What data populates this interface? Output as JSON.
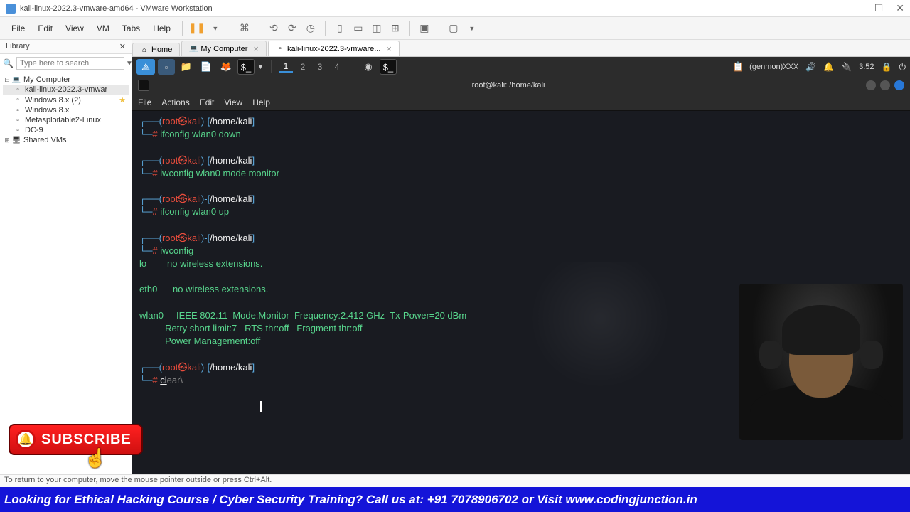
{
  "window": {
    "title": "kali-linux-2022.3-vmware-amd64 - VMware Workstation"
  },
  "menubar": {
    "items": [
      "File",
      "Edit",
      "View",
      "VM",
      "Tabs",
      "Help"
    ]
  },
  "library": {
    "title": "Library",
    "search_placeholder": "Type here to search",
    "tree": {
      "my_computer": "My Computer",
      "kali": "kali-linux-2022.3-vmwar",
      "win8x2": "Windows 8.x (2)",
      "win8x": "Windows 8.x",
      "metasploit": "Metasploitable2-Linux",
      "dc9": "DC-9",
      "shared": "Shared VMs"
    }
  },
  "tabs": {
    "home": "Home",
    "my_computer": "My Computer",
    "kali": "kali-linux-2022.3-vmware..."
  },
  "kali_taskbar": {
    "workspaces": [
      "1",
      "2",
      "3",
      "4"
    ],
    "genmon": "(genmon)XXX",
    "clock": "3:52"
  },
  "terminal": {
    "title": "root@kali: /home/kali",
    "menu": [
      "File",
      "Actions",
      "Edit",
      "View",
      "Help"
    ],
    "prompt": {
      "user": "root",
      "at": "㉿",
      "host": "kali",
      "path": "/home/kali"
    },
    "commands": {
      "c1": "ifconfig wlan0 down",
      "c2": "iwconfig wlan0 mode monitor",
      "c3": "ifconfig wlan0 up",
      "c4": "iwconfig",
      "c5_typed": "cl",
      "c5_ghost": "ear\\"
    },
    "output": {
      "lo": "lo        no wireless extensions.",
      "eth0": "eth0      no wireless extensions.",
      "wlan0_1": "wlan0     IEEE 802.11  Mode:Monitor  Frequency:2.412 GHz  Tx-Power=20 dBm",
      "wlan0_2": "          Retry short limit:7   RTS thr:off   Fragment thr:off",
      "wlan0_3": "          Power Management:off"
    }
  },
  "statusbar": {
    "text": "To return to your computer, move the mouse pointer outside or press Ctrl+Alt."
  },
  "subscribe": {
    "label": "SUBSCRIBE"
  },
  "banner": {
    "text": "Looking for Ethical Hacking Course / Cyber Security Training? Call us at: +91 7078906702 or Visit www.codingjunction.in"
  }
}
